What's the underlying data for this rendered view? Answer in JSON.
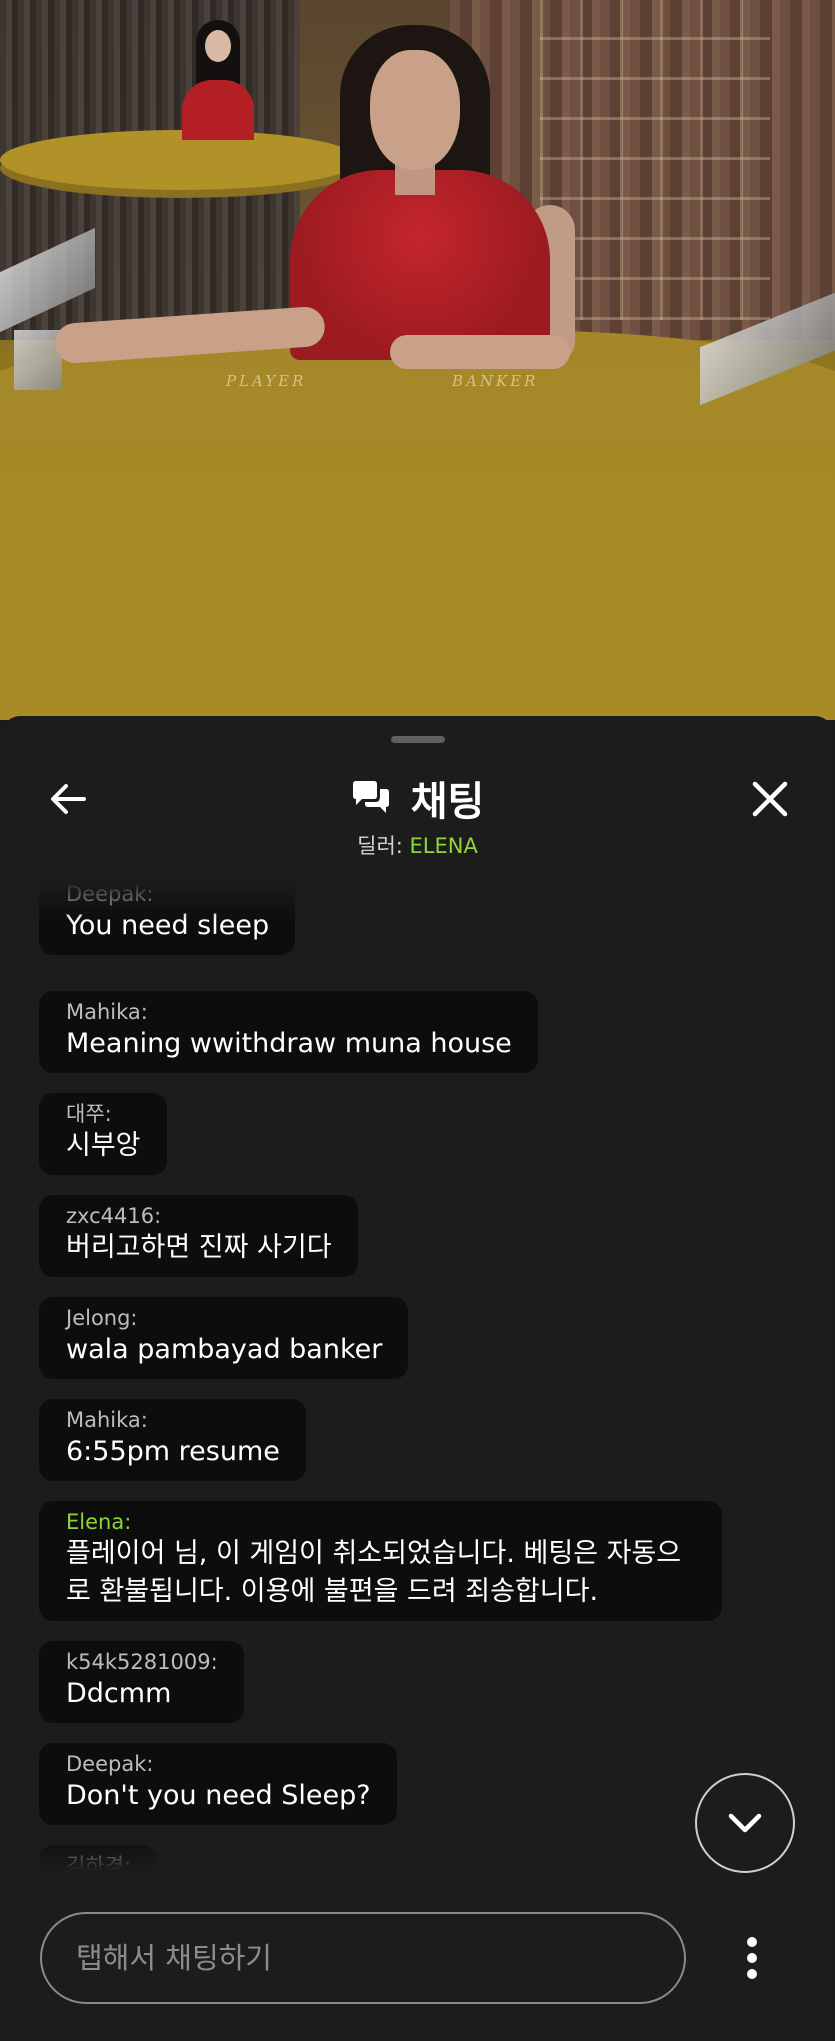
{
  "video": {
    "table_labels": {
      "player": "PLAYER",
      "banker": "BANKER"
    }
  },
  "header": {
    "title": "채팅",
    "subtitle_prefix": "딜러: ",
    "dealer_name": "ELENA",
    "back_icon": "arrow-left-icon",
    "chat_icon": "chat-bubbles-icon",
    "close_icon": "close-icon"
  },
  "messages": [
    {
      "user": "Deepak:",
      "text": "You need sleep"
    },
    {
      "user": "Mahika:",
      "text": "Meaning wwithdraw muna house"
    },
    {
      "user": "대쭈:",
      "text": "시부앙"
    },
    {
      "user": "zxc4416:",
      "text": "버리고하면 진짜 사기다"
    },
    {
      "user": "Jelong:",
      "text": "wala pambayad banker"
    },
    {
      "user": "Mahika:",
      "text": "6:55pm resume"
    },
    {
      "user": "Elena:",
      "text": "플레이어 님, 이 게임이 취소되었습니다. 베팅은 자동으로 환불됩니다. 이용에 불편을 드려 죄송합니다.",
      "host": true
    },
    {
      "user": "k54k5281009:",
      "text": "Ddcmm"
    },
    {
      "user": "Deepak:",
      "text": "Don't you need Sleep?"
    },
    {
      "user": "김하경:",
      "text": ""
    }
  ],
  "controls": {
    "scroll_down_icon": "chevron-down-icon",
    "input_placeholder": "탭해서 채팅하기",
    "more_icon": "more-vertical-icon"
  },
  "colors": {
    "panel_bg": "#1c1c1c",
    "bubble_bg": "#0d0d0d",
    "host_accent": "#8fd43c",
    "text": "#ffffff"
  }
}
